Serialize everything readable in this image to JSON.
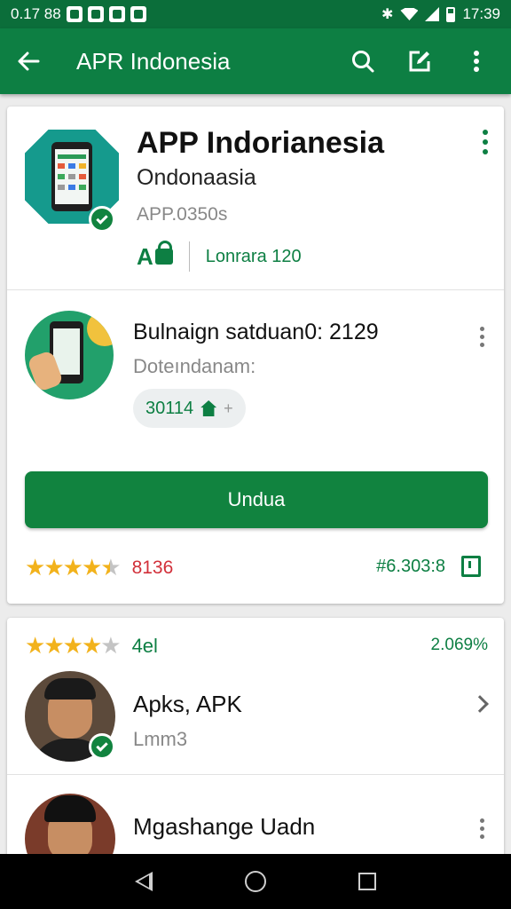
{
  "status_bar": {
    "time_left": "0.17 88",
    "time_right": "17:39"
  },
  "app_bar": {
    "title": "APR Indonesia"
  },
  "app": {
    "name": "APP Indorianesia",
    "developer": "Ondonaasia",
    "meta": "APP.0350s",
    "content_rating_label": "A",
    "rating_text": "Lonrara 120"
  },
  "promo": {
    "title": "Bulnaign satduan0: 2129",
    "subtitle": "Doteındanam:",
    "chip_label": "30114",
    "chip_plus": "+"
  },
  "download_button": {
    "label": "Undua"
  },
  "stats": {
    "stars": 4.5,
    "count": "8136",
    "right_value": "#6.303:8"
  },
  "reviews": {
    "stars": 4,
    "score": "4el",
    "percent": "2.069%",
    "items": [
      {
        "name": "Apks, APK",
        "sub": "Lmm3"
      },
      {
        "name": "Mgashange Uadn",
        "sub": ""
      }
    ]
  },
  "colors": {
    "primary": "#0d7f43",
    "status_bar": "#0b6e3a",
    "star": "#f2b21b",
    "count": "#d2303a"
  }
}
